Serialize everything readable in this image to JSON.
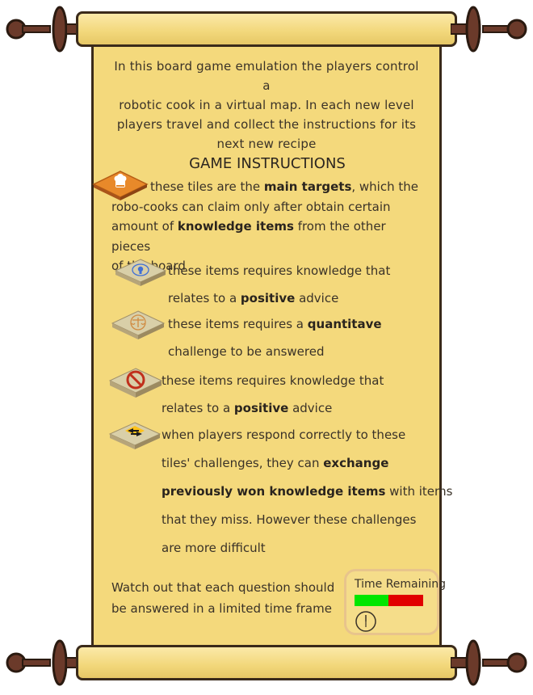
{
  "intro": {
    "line1": "In this board game emulation the players control a",
    "line2": "robotic cook in a virtual map. In each new level",
    "line3": "players travel and collect the instructions for its",
    "line4": "next new recipe"
  },
  "instructions_title": "GAME INSTRUCTIONS",
  "main_target": {
    "text_a": "these tiles are the ",
    "bold_a": "main targets",
    "text_b": ", which the",
    "text_c": "robo-cooks can claim only after obtain certain",
    "text_d": "amount of ",
    "bold_b": "knowledge items",
    "text_e": " from the other pieces",
    "text_f": "of the board"
  },
  "items": [
    {
      "icon": "lightbulb-icon",
      "line1": "these items requires knowledge that",
      "line2a": "relates to a ",
      "line2b": "positive",
      "line2c": " advice"
    },
    {
      "icon": "scales-icon",
      "line1a": "these items requires a ",
      "line1b": "quantitave",
      "line2": "challenge to be answered"
    },
    {
      "icon": "prohibited-icon",
      "line1": "these items requires knowledge that",
      "line2a": "relates to a ",
      "line2b": "positive",
      "line2c": " advice"
    },
    {
      "icon": "exchange-arrows-icon",
      "line1": "when players respond correctly to these",
      "line2a": "tiles' challenges, they can ",
      "line2b": "exchange",
      "line3a": "previously won knowledge items",
      "line3b": " with items",
      "line4": "that they miss. However these challenges",
      "line5": "are more difficult"
    }
  ],
  "footer": {
    "line1": "Watch out that each question should",
    "line2": "be answered in a limited time frame"
  },
  "timer": {
    "label": "Time Remaining",
    "remaining_fraction": 0.49,
    "colors": {
      "remaining": "#00e600",
      "elapsed": "#e10000"
    },
    "icon": "clock-icon"
  },
  "colors": {
    "parchment": "#f4d97c",
    "roller": "#f2d77a",
    "wood": "#6b3a2a",
    "tile_main": "#e8892a"
  }
}
